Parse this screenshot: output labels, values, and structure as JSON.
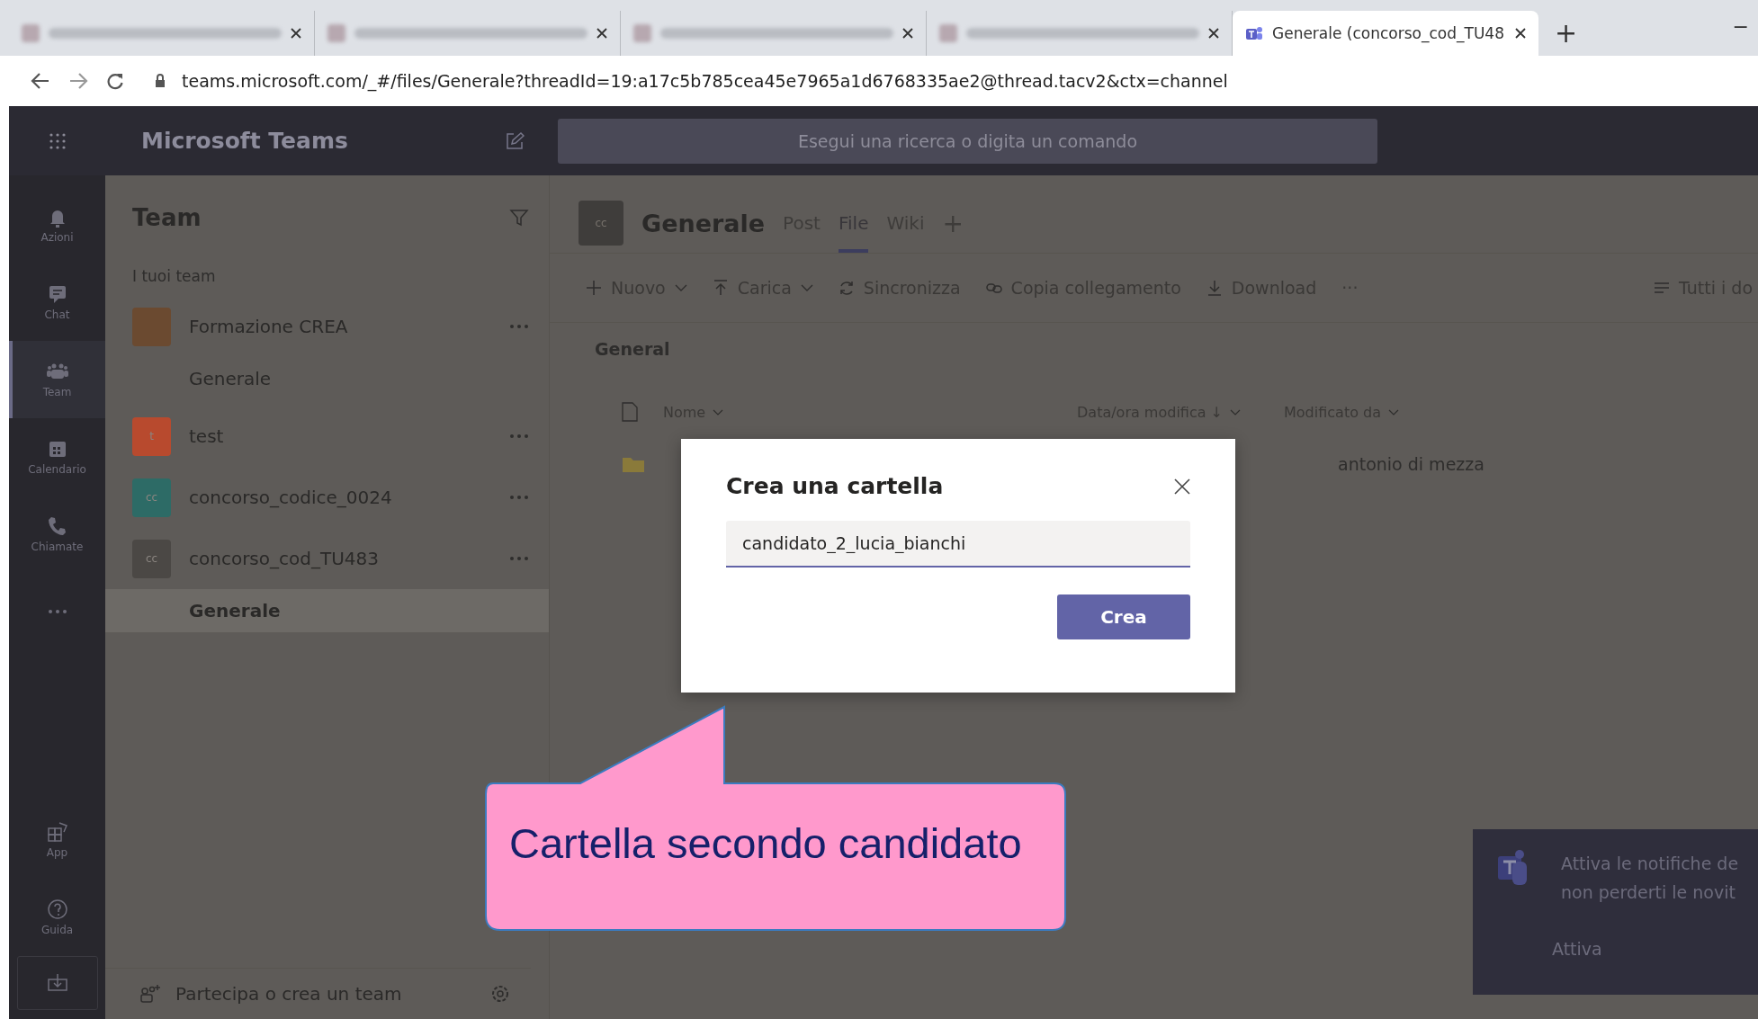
{
  "browser": {
    "tabs": [
      {
        "selected": false
      },
      {
        "selected": false
      },
      {
        "selected": false
      },
      {
        "selected": false
      },
      {
        "title": "Generale (concorso_cod_TU48",
        "selected": true
      }
    ],
    "new_tab": "+",
    "minimize": "−",
    "address": "teams.microsoft.com/_#/files/Generale?threadId=19:a17c5b785cea45e7965a1d6768335ae2@thread.tacv2&ctx=channel"
  },
  "app_header": {
    "title": "Microsoft Teams",
    "search": {
      "placeholder": "Esegui una ricerca o digita un comando"
    }
  },
  "rail": {
    "items": [
      {
        "kind": "bell",
        "label": "Azioni",
        "selected": false
      },
      {
        "kind": "chat",
        "label": "Chat",
        "selected": false
      },
      {
        "kind": "team",
        "label": "Team",
        "selected": true
      },
      {
        "kind": "calendar",
        "label": "Calendario",
        "selected": false
      },
      {
        "kind": "phone",
        "label": "Chiamate",
        "selected": false
      },
      {
        "kind": "more",
        "selected": false
      }
    ],
    "bottom_items": [
      {
        "kind": "apps",
        "label": "App"
      },
      {
        "kind": "help",
        "label": "Guida"
      },
      {
        "kind": "download"
      }
    ]
  },
  "sidebar": {
    "title": "Team",
    "section": "I tuoi team",
    "teams": [
      {
        "name": "Formazione CREA",
        "color": "#6b4a30",
        "channels": [
          {
            "name": "Generale",
            "selected": false
          }
        ]
      },
      {
        "name": "test",
        "avatar": "t",
        "color": "#b84a2e"
      },
      {
        "name": "concorso_codice_0024",
        "avatar": "cc",
        "color": "#2d6b66"
      },
      {
        "name": "concorso_cod_TU483",
        "avatar": "cc",
        "color": "#4b4845",
        "channels": [
          {
            "name": "Generale",
            "selected": true
          }
        ]
      }
    ],
    "footer": "Partecipa o crea un team"
  },
  "channel": {
    "avatar": "cc",
    "name": "Generale",
    "tabs": [
      {
        "label": "Post",
        "selected": false
      },
      {
        "label": "File",
        "selected": true
      },
      {
        "label": "Wiki",
        "selected": false
      }
    ],
    "add_tab": "+",
    "toolbar": [
      {
        "kind": "plus",
        "label": "Nuovo",
        "dropdown": true
      },
      {
        "kind": "upload",
        "label": "Carica",
        "dropdown": true
      },
      {
        "kind": "sync",
        "label": "Sincronizza",
        "dropdown": false
      },
      {
        "kind": "link",
        "label": "Copia collegamento",
        "dropdown": false
      },
      {
        "kind": "download",
        "label": "Download",
        "dropdown": false
      },
      {
        "kind": "more",
        "label": "···",
        "dropdown": false
      }
    ],
    "view": "Tutti i do",
    "folder": "General",
    "columns": [
      "Nome",
      "Data/ora modifica ↓",
      "Modificato da"
    ],
    "rows": [
      {
        "modified_by": "antonio di mezza"
      }
    ]
  },
  "dialog": {
    "title": "Crea una cartella",
    "field": {
      "value": "candidato_2_lucia_bianchi"
    },
    "button": "Crea"
  },
  "callout": {
    "text": "Cartella secondo candidato"
  },
  "notification": {
    "lines": [
      "Attiva le notifiche de",
      "non perderti le novit"
    ],
    "button": "Attiva"
  }
}
